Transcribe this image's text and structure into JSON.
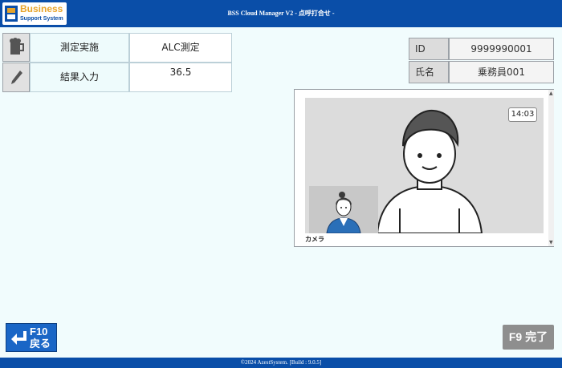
{
  "app": {
    "logo_line1": "Business",
    "logo_line2": "Support System",
    "window_title": "BSS Cloud Manager V2 - 点呼打合せ -"
  },
  "measurement": {
    "rows": [
      {
        "label": "測定実施",
        "value": "ALC測定",
        "icon": "beer-mug-icon"
      },
      {
        "label": "結果入力",
        "value": "36.5",
        "icon": "pen-icon"
      }
    ]
  },
  "person": {
    "id_label": "ID",
    "id_value": "9999990001",
    "name_label": "氏名",
    "name_value": "乗務員001"
  },
  "camera": {
    "label": "カメラ",
    "clock": "14:03"
  },
  "buttons": {
    "back_key": "F10",
    "back_label": "戻る",
    "done_label": "F9 完了"
  },
  "footer": {
    "copyright": "©2024 AzestSystem.  [Build : 9.0.5]"
  },
  "colors": {
    "title_bar": "#0a4ea8",
    "background": "#f1fcfd",
    "back_button": "#1a66c6",
    "done_button": "#8e8e8e"
  }
}
